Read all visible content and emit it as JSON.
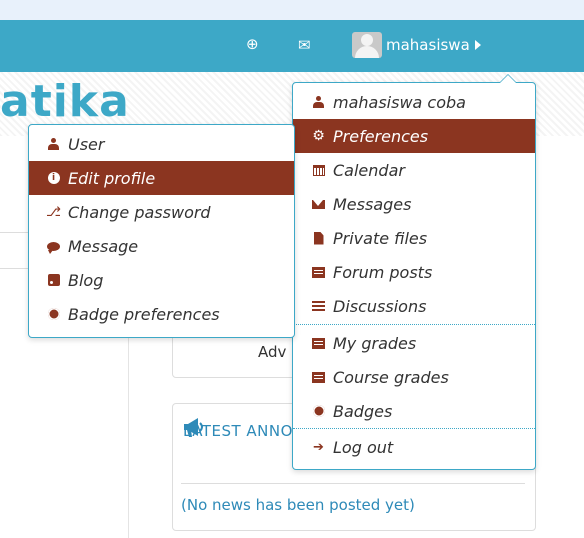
{
  "navbar": {
    "notifications_icon": "notification-icon",
    "messages_icon": "message-icon",
    "username": "mahasiswa"
  },
  "site": {
    "title_fragment": "atika"
  },
  "blocks": {
    "advanced_text": "Adv",
    "news_title": "LATEST ANNOUNCEMENTS",
    "news_empty": "(No news has been posted yet)"
  },
  "user_menu": {
    "items": [
      {
        "label": "mahasiswa coba",
        "icon": "user-icon"
      },
      {
        "label": "Preferences",
        "icon": "gear-icon",
        "active": true
      },
      {
        "label": "Calendar",
        "icon": "calendar-icon"
      },
      {
        "label": "Messages",
        "icon": "envelope-icon"
      },
      {
        "label": "Private files",
        "icon": "file-icon"
      },
      {
        "label": "Forum posts",
        "icon": "list-alt-icon"
      },
      {
        "label": "Discussions",
        "icon": "list-icon"
      },
      {
        "label": "My grades",
        "icon": "list-alt-icon"
      },
      {
        "label": "Course grades",
        "icon": "list-alt-icon"
      },
      {
        "label": "Badges",
        "icon": "badge-icon"
      },
      {
        "label": "Log out",
        "icon": "sign-out-icon"
      }
    ]
  },
  "preferences_submenu": {
    "items": [
      {
        "label": "User",
        "icon": "user-icon"
      },
      {
        "label": "Edit profile",
        "icon": "info-icon",
        "active": true
      },
      {
        "label": "Change password",
        "icon": "key-icon"
      },
      {
        "label": "Message",
        "icon": "chat-icon"
      },
      {
        "label": "Blog",
        "icon": "rss-icon"
      },
      {
        "label": "Badge preferences",
        "icon": "badge-icon"
      }
    ]
  },
  "colors": {
    "navbar": "#3da8c7",
    "active_item": "#8b3520",
    "link": "#2e8ab8"
  }
}
